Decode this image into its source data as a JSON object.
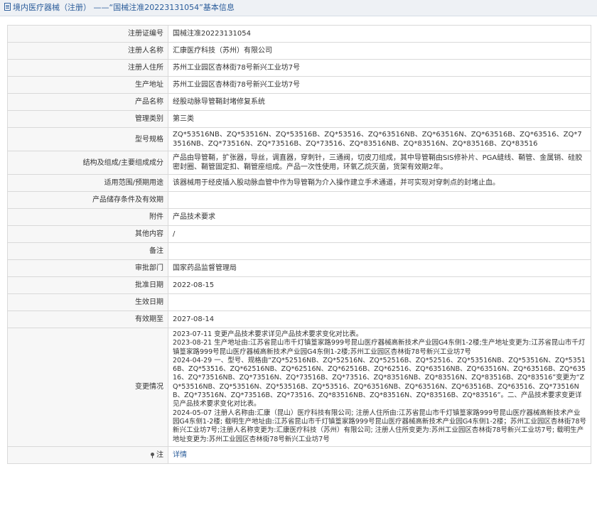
{
  "header": {
    "category": "境内医疗器械（注册）",
    "separator": "——",
    "reg_no_quoted": "“国械注准20223131054”",
    "suffix": "基本信息"
  },
  "fields": [
    {
      "label": "注册证编号",
      "value": "国械注准20223131054"
    },
    {
      "label": "注册人名称",
      "value": "汇康医疗科技（苏州）有限公司"
    },
    {
      "label": "注册人住所",
      "value": "苏州工业园区杏林街78号新兴工业坊7号"
    },
    {
      "label": "生产地址",
      "value": "苏州工业园区杏林街78号新兴工业坊7号"
    },
    {
      "label": "产品名称",
      "value": "经股动脉导管鞘封堵修复系统"
    },
    {
      "label": "管理类别",
      "value": "第三类"
    },
    {
      "label": "型号规格",
      "value": "ZQ*53516NB、ZQ*53516N、ZQ*53516B、ZQ*53516、ZQ*63516NB、ZQ*63516N、ZQ*63516B、ZQ*63516、ZQ*73516NB、ZQ*73516N、ZQ*73516B、ZQ*73516、ZQ*83516NB、ZQ*83516N、ZQ*83516B、ZQ*83516"
    },
    {
      "label": "结构及组成/主要组成成分",
      "value": "产品由导管鞘，扩张器，导丝，调直器，穿刺针，三通阀，切皮刀组成，其中导管鞘由SIS修补片、PGA缝线、鞘管、金属销、硅胶密封圈、鞘管固定扣、鞘管座组成。产品一次性使用，环氧乙烷灭菌，货架有效期2年。"
    },
    {
      "label": "适用范围/预期用途",
      "value": "该器械用于经皮插入股动脉血管中作为导管鞘为介入操作建立手术通道，并可实现对穿刺点的封堵止血。"
    },
    {
      "label": "产品储存条件及有效期",
      "value": ""
    },
    {
      "label": "附件",
      "value": "产品技术要求"
    },
    {
      "label": "其他内容",
      "value": "/"
    },
    {
      "label": "备注",
      "value": ""
    },
    {
      "label": "审批部门",
      "value": "国家药品监督管理局"
    },
    {
      "label": "批准日期",
      "value": "2022-08-15"
    },
    {
      "label": "生效日期",
      "value": ""
    },
    {
      "label": "有效期至",
      "value": "2027-08-14"
    }
  ],
  "changes": {
    "label": "变更情况",
    "entries": [
      "2023-07-11 变更产品技术要求详见产品技术要求变化对比表。",
      "2023-08-21 生产地址由:江苏省昆山市千灯镇篁家路999号昆山医疗器械高新技术产业园G4东侧1-2楼;生产地址变更为:江苏省昆山市千灯镇篁家路999号昆山医疗器械高新技术产业园G4东侧1-2楼;苏州工业园区杏林街78号新兴工业坊7号",
      "2024-04-29 一、型号、规格由“ZQ*52516NB、ZQ*52516N、ZQ*52516B、ZQ*52516、ZQ*53516NB、ZQ*53516N、ZQ*53516B、ZQ*53516、ZQ*62516NB、ZQ*62516N、ZQ*62516B、ZQ*62516、ZQ*63516NB、ZQ*63516N、ZQ*63516B、ZQ*63516、ZQ*73516NB、ZQ*73516N、ZQ*73516B、ZQ*73516、ZQ*83516NB、ZQ*83516N、ZQ*83516B、ZQ*83516”变更为“ZQ*53516NB、ZQ*53516N、ZQ*53516B、ZQ*53516、ZQ*63516NB、ZQ*63516N、ZQ*63516B、ZQ*63516、ZQ*73516NB、ZQ*73516N、ZQ*73516B、ZQ*73516、ZQ*83516NB、ZQ*83516N、ZQ*83516B、ZQ*83516”。二、产品技术要求变更详见产品技术要求变化对比表。",
      "2024-05-07 注册人名称由:汇康（昆山）医疗科技有限公司; 注册人住所由:江苏省昆山市千灯镇篁家路999号昆山医疗器械高新技术产业园G4东侧1-2楼; 载明生产地址由:江苏省昆山市千灯镇篁家路999号昆山医疗器械高新技术产业园G4东侧1-2楼；苏州工业园区杏林街78号新兴工业坊7号;注册人名称变更为:汇康医疗科技（苏州）有限公司; 注册人住所变更为:苏州工业园区杏林街78号新兴工业坊7号; 载明生产地址变更为:苏州工业园区杏林街78号新兴工业坊7号"
    ]
  },
  "note": {
    "label": "注",
    "link_text": "详情",
    "icon": "pin-icon"
  },
  "colors": {
    "title_text": "#2a5c9a",
    "title_bg": "#eef1f5",
    "border": "#d9d9d9",
    "label_bg": "#f7f7f7"
  }
}
